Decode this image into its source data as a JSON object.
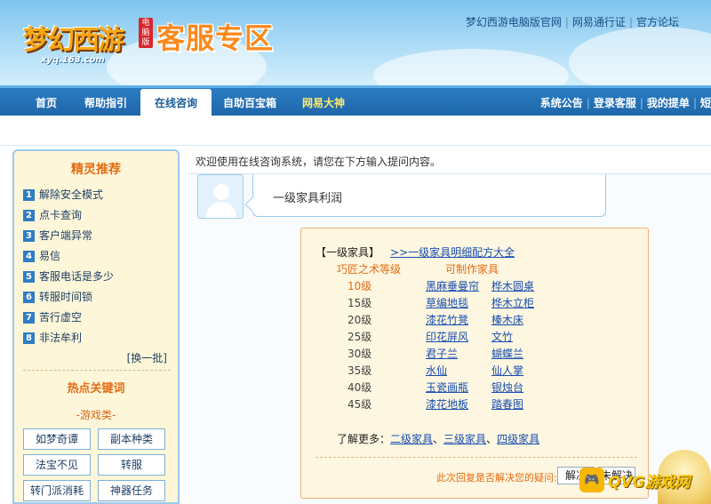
{
  "header": {
    "logo_text": "梦幻西游",
    "logo_badge": "电脑版",
    "logo_url": "xyq.163.com",
    "title": "客服专区",
    "top_links": [
      "梦幻西游电脑版官网",
      "网易通行证",
      "官方论坛"
    ]
  },
  "nav": {
    "items": [
      "首页",
      "帮助指引",
      "在线咨询",
      "自助百宝箱",
      "网易大神"
    ],
    "active_index": 2,
    "right_links": [
      "系统公告",
      "登录客服",
      "我的提单",
      "短"
    ]
  },
  "sidebar": {
    "title": "精灵推荐",
    "items": [
      {
        "num": "1",
        "label": "解除安全模式"
      },
      {
        "num": "2",
        "label": "点卡查询"
      },
      {
        "num": "3",
        "label": "客户端异常"
      },
      {
        "num": "4",
        "label": "易信"
      },
      {
        "num": "5",
        "label": "客服电话是多少"
      },
      {
        "num": "6",
        "label": "转服时间锁"
      },
      {
        "num": "7",
        "label": "苦行虚空"
      },
      {
        "num": "8",
        "label": "非法牟利"
      }
    ],
    "more": "[换一批]",
    "hot_title": "热点关键词",
    "hot_category": "-游戏类-",
    "keywords": [
      "如梦奇谭",
      "副本种类",
      "法宝不见",
      "转服",
      "转门派消耗",
      "神器任务"
    ]
  },
  "main": {
    "notice": "欢迎使用在线咨询系统，请您在下方输入提问内容。",
    "question": "一级家具利润",
    "answer": {
      "head": "【一级家具】",
      "head_link": ">>一级家具明细配方大全",
      "col_level": "巧匠之术等级",
      "col_items": "可制作家具",
      "rows": [
        {
          "level": "10级",
          "item1": "黑麻垂曼帘",
          "item2": "桦木圆桌"
        },
        {
          "level": "15级",
          "item1": "草编地毯",
          "item2": "桦木立柜"
        },
        {
          "level": "20级",
          "item1": "漆花竹凳",
          "item2": "榛木床"
        },
        {
          "level": "25级",
          "item1": "印花屏风",
          "item2": "文竹"
        },
        {
          "level": "30级",
          "item1": "君子兰",
          "item2": "蝴蝶兰"
        },
        {
          "level": "35级",
          "item1": "水仙",
          "item2": "仙人掌"
        },
        {
          "level": "40级",
          "item1": "玉瓷画瓶",
          "item2": "银烛台"
        },
        {
          "level": "45级",
          "item1": "漆花地板",
          "item2": "踏春图"
        }
      ],
      "more_label": "了解更多：",
      "more_links": [
        "二级家具",
        "三级家具",
        "四级家具"
      ],
      "feedback": "此次回复是否解决您的疑问:",
      "solve": "解决",
      "unsolve": "未解决"
    }
  },
  "watermark": {
    "badge": "🎮",
    "text": "QVG游戏网"
  }
}
